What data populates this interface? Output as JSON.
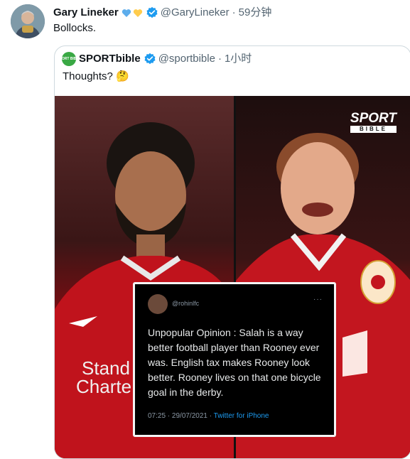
{
  "tweet": {
    "author_name": "Gary Lineker",
    "emoji": [
      "blue-heart",
      "yellow-heart"
    ],
    "handle": "@GaryLineker",
    "separator": "·",
    "time": "59分钟",
    "text": "Bollocks."
  },
  "quote": {
    "author_name": "SPORTbible",
    "avatar_text": "SPORT BIBLE",
    "handle": "@sportbible",
    "separator": "·",
    "time": "1小时",
    "text": "Thoughts? 🤔",
    "media": {
      "logo_line1": "SPORT",
      "logo_line2": "BIBLE",
      "left_shirt_text": "Stand\nCharte",
      "screenshot": {
        "handle": "@rohinlfc",
        "menu": "···",
        "body": "Unpopular Opinion : Salah is a way better football player than Rooney ever was. English tax makes Rooney look better. Rooney lives on that one bicycle goal in the derby.",
        "timestamp": "07:25 · 29/07/2021 · ",
        "source": "Twitter for iPhone"
      }
    }
  },
  "colors": {
    "verified": "#1d9bf0",
    "secondary_text": "#536471",
    "border": "#cfd9de",
    "liverpool_red": "#b3101a",
    "united_red": "#b9141c"
  }
}
